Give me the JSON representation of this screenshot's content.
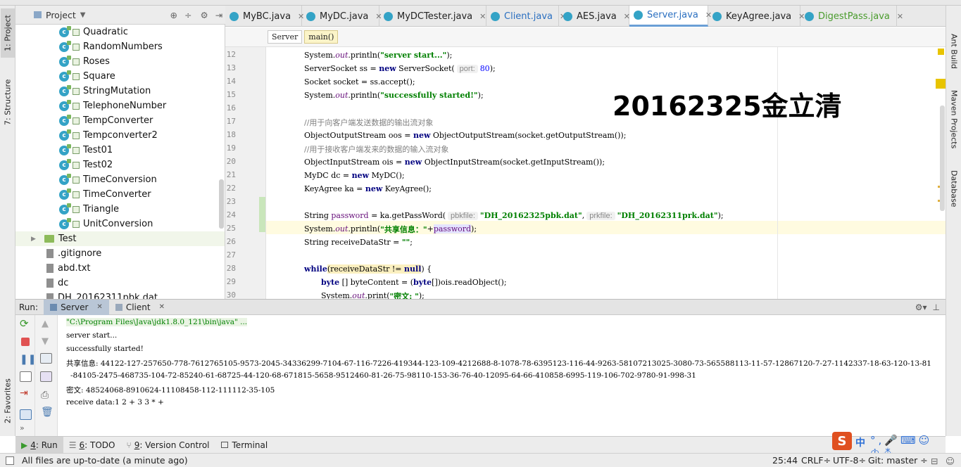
{
  "project_panel": {
    "title": "Project",
    "items": [
      {
        "name": "Quadratic",
        "kind": "class"
      },
      {
        "name": "RandomNumbers",
        "kind": "class"
      },
      {
        "name": "Roses",
        "kind": "class"
      },
      {
        "name": "Square",
        "kind": "class"
      },
      {
        "name": "StringMutation",
        "kind": "class"
      },
      {
        "name": "TelephoneNumber",
        "kind": "class"
      },
      {
        "name": "TempConverter",
        "kind": "class"
      },
      {
        "name": "Tempconverter2",
        "kind": "class"
      },
      {
        "name": "Test01",
        "kind": "class"
      },
      {
        "name": "Test02",
        "kind": "class"
      },
      {
        "name": "TimeConversion",
        "kind": "class"
      },
      {
        "name": "TimeConverter",
        "kind": "class"
      },
      {
        "name": "Triangle",
        "kind": "class"
      },
      {
        "name": "UnitConversion",
        "kind": "class"
      },
      {
        "name": "Test",
        "kind": "folder"
      },
      {
        "name": ".gitignore",
        "kind": "file"
      },
      {
        "name": "abd.txt",
        "kind": "file"
      },
      {
        "name": "dc",
        "kind": "file"
      },
      {
        "name": "DH_20162311pbk.dat",
        "kind": "file"
      }
    ]
  },
  "left_toolbar": {
    "project": "1: Project",
    "structure": "7: Structure",
    "favorites": "2: Favorites"
  },
  "right_toolbar": {
    "ant": "Ant Build",
    "maven": "Maven Projects",
    "database": "Database"
  },
  "editor_tabs": [
    {
      "label": "MyBC.java",
      "style": "normal"
    },
    {
      "label": "MyDC.java",
      "style": "normal"
    },
    {
      "label": "MyDCTester.java",
      "style": "normal"
    },
    {
      "label": "Client.java",
      "style": "blue"
    },
    {
      "label": "AES.java",
      "style": "normal"
    },
    {
      "label": "Server.java",
      "style": "blue",
      "active": true
    },
    {
      "label": "KeyAgree.java",
      "style": "normal"
    },
    {
      "label": "DigestPass.java",
      "style": "green"
    }
  ],
  "breadcrumb": [
    "Server",
    "main()"
  ],
  "code_lines": [
    12,
    13,
    14,
    15,
    16,
    17,
    18,
    19,
    20,
    21,
    22,
    23,
    24,
    25,
    26,
    27,
    28,
    29,
    30
  ],
  "code": {
    "l12_a": "System.",
    "l12_b": "out",
    "l12_c": ".println(",
    "l12_d": "\"server start...\"",
    "l12_e": ");",
    "l13_a": "ServerSocket ss = ",
    "l13_b": "new",
    "l13_c": " ServerSocket(",
    "l13_hint": "port:",
    "l13_d": "80",
    "l13_e": ");",
    "l14": "Socket socket = ss.accept();",
    "l15_a": "System.",
    "l15_b": "out",
    "l15_c": ".println(",
    "l15_d": "\"successfully started!\"",
    "l15_e": ");",
    "l17": "//用于向客户端发送数据的输出流对象",
    "l18_a": "ObjectOutputStream oos = ",
    "l18_b": "new",
    "l18_c": " ObjectOutputStream(socket.getOutputStream());",
    "l19": "//用于接收客户端发来的数据的输入流对象",
    "l20_a": "ObjectInputStream ois = ",
    "l20_b": "new",
    "l20_c": " ObjectInputStream(socket.getInputStream());",
    "l21_a": "MyDC dc = ",
    "l21_b": "new",
    "l21_c": " MyDC();",
    "l22_a": "KeyAgree ka = ",
    "l22_b": "new",
    "l22_c": " KeyAgree();",
    "l24_a": "String ",
    "l24_b": "password",
    "l24_c": " = ka.getPassWord(",
    "l24_hint1": "pbkfile:",
    "l24_d": "\"DH_20162325pbk.dat\"",
    "l24_e": ",",
    "l24_hint2": "prkfile:",
    "l24_f": "\"DH_20162311prk.dat\"",
    "l24_g": ");",
    "l25_a": "System.",
    "l25_b": "out",
    "l25_c": ".println(",
    "l25_d": "\"共享信息：\"",
    "l25_e": "+",
    "l25_f": "password",
    "l25_g": ");",
    "l26_a": "String receiveDataStr = ",
    "l26_b": "\"\"",
    "l26_c": ";",
    "l28_a": "while",
    "l28_b": "(receiveDataStr != ",
    "l28_c": "null",
    "l28_d": ") {",
    "l29_a": "byte",
    "l29_b": " [] byteContent = (",
    "l29_c": "byte",
    "l29_d": "[])ois.readObject();",
    "l30_a": "System.",
    "l30_b": "out",
    "l30_c": ".print(",
    "l30_d": "\"密文: \"",
    "l30_e": ");"
  },
  "watermark": "20162325金立清",
  "run_panel": {
    "label": "Run:",
    "tabs": [
      "Server",
      "Client"
    ],
    "console": [
      "\"C:\\Program Files\\Java\\jdk1.8.0_121\\bin\\java\" ...",
      "server start...",
      "successfully started!",
      "共享信息: 44122-127-257650-778-7612765105-9573-2045-34336299-7104-67-116-7226-419344-123-109-4212688-8-1078-78-6395123-116-44-9263-58107213025-3080-73-565588113-11-57-12867120-7-27-1142337-18-63-120-13-81",
      "-84105-2475-468735-104-72-85240-61-68725-44-120-68-671815-5658-9512460-81-26-75-98110-153-36-76-40-12095-64-66-410858-6995-119-106-702-9780-91-998-31",
      "密文: 48524068-8910624-11108458-112-111112-35-105",
      "receive data:1 2 + 3 3 * +"
    ]
  },
  "tool_windows": [
    {
      "key": "4",
      "label": ": Run",
      "active": true
    },
    {
      "key": "6",
      "label": ": TODO"
    },
    {
      "key": "9",
      "label": ": Version Control"
    },
    {
      "key": "",
      "label": "Terminal"
    }
  ],
  "status_bar": {
    "message": "All files are up-to-date (a minute ago)",
    "position": "25:44",
    "line_sep": "CRLF÷",
    "encoding": "UTF-8÷",
    "vcs": "Git: master ÷"
  },
  "ime": {
    "logo": "S",
    "mode": "中"
  },
  "colors": {
    "keyword": "#000080",
    "string": "#008000",
    "field": "#660e7a",
    "comment": "#808080",
    "accent": "#6a9ed6"
  }
}
